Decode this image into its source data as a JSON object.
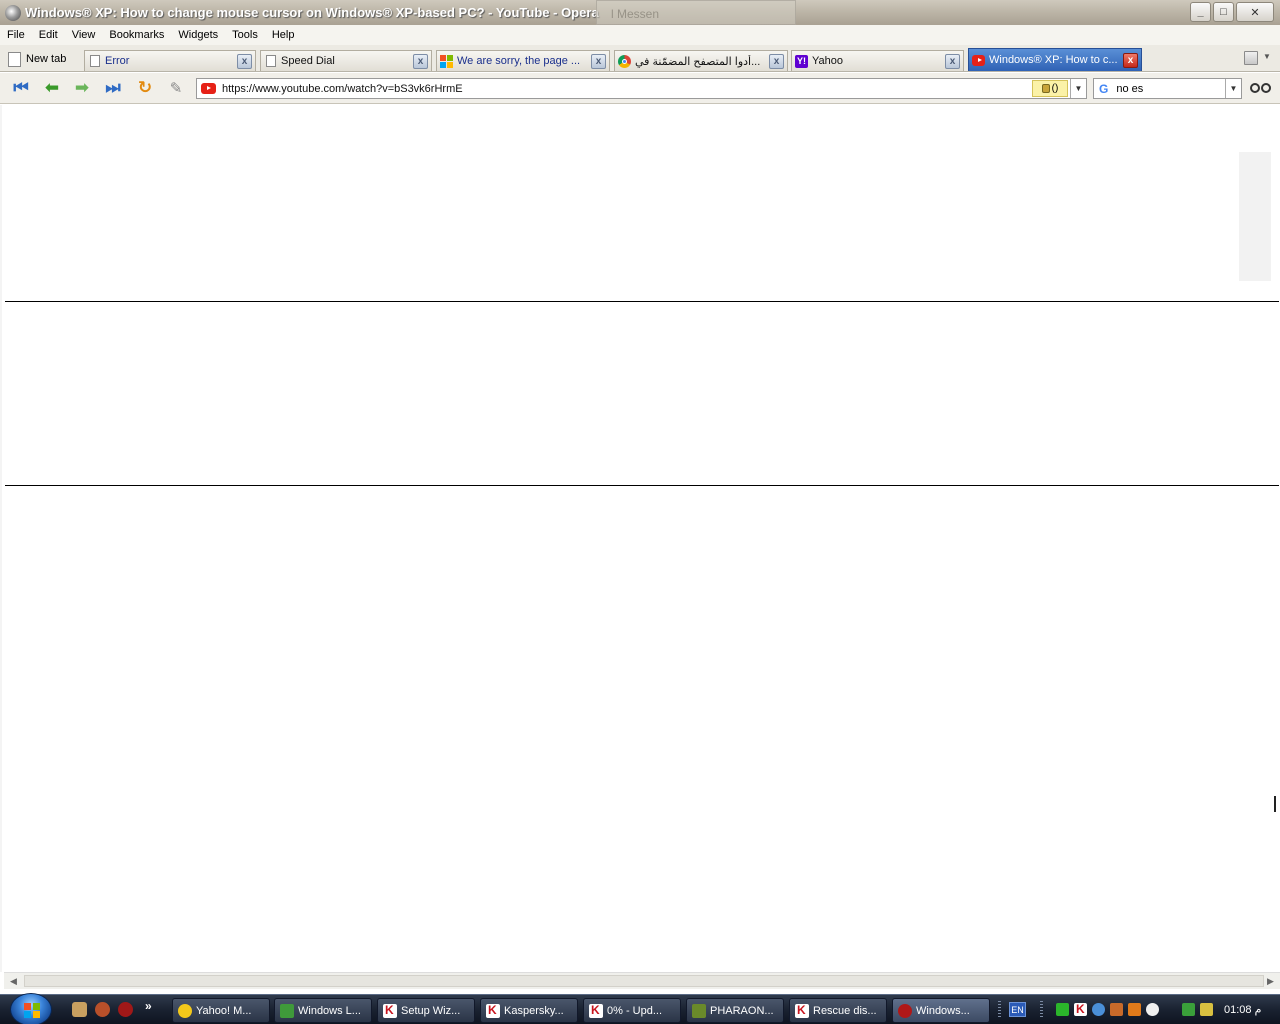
{
  "window": {
    "title": "Windows® XP: How to change mouse cursor on Windows® XP-based PC? - YouTube - Opera",
    "ghost_window_label": "l Messen"
  },
  "menu": [
    "File",
    "Edit",
    "View",
    "Bookmarks",
    "Widgets",
    "Tools",
    "Help"
  ],
  "tabs": {
    "new_tab_label": "New tab",
    "items": [
      {
        "label": "Error",
        "icon": "page-icon",
        "active": false
      },
      {
        "label": "Speed Dial",
        "icon": "speed-dial-icon",
        "active": false
      },
      {
        "label": "We are sorry, the page ...",
        "icon": "windows-flag-icon",
        "active": false
      },
      {
        "label": "أدوا المتصفح المضمّنة في...",
        "icon": "chrome-icon",
        "active": false
      },
      {
        "label": "Yahoo",
        "icon": "yahoo-icon",
        "active": false
      },
      {
        "label": "Windows® XP: How to c...",
        "icon": "youtube-icon",
        "active": true
      }
    ],
    "close_glyph": "x"
  },
  "address_bar": {
    "url": "https://www.youtube.com/watch?v=bS3vk6rHrmE",
    "security_label": "()"
  },
  "search": {
    "engine_icon": "G",
    "query": "no es"
  },
  "taskbar": {
    "quick_launch_more": "»",
    "buttons": [
      {
        "label": "Yahoo! M...",
        "icon": "yahoo-messenger-icon",
        "active": false
      },
      {
        "label": "Windows L...",
        "icon": "windows-live-icon",
        "active": false
      },
      {
        "label": "Setup Wiz...",
        "icon": "kaspersky-icon",
        "active": false
      },
      {
        "label": "Kaspersky...",
        "icon": "kaspersky-icon",
        "active": false
      },
      {
        "label": "0% - Upd...",
        "icon": "kaspersky-icon",
        "active": false
      },
      {
        "label": "PHARAON...",
        "icon": "pharaon-icon",
        "active": false
      },
      {
        "label": "Rescue dis...",
        "icon": "kaspersky-icon",
        "active": false
      },
      {
        "label": "Windows...",
        "icon": "opera-icon",
        "active": true
      }
    ],
    "language": "EN",
    "clock": "01:08 م"
  },
  "colors": {
    "active_tab": "#2f62b5",
    "close_red": "#c4281a",
    "taskbar": "#1a2231"
  }
}
